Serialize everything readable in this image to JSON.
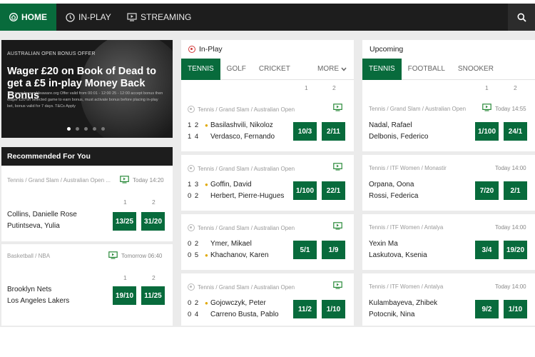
{
  "nav": {
    "home": "HOME",
    "inplay": "IN-PLAY",
    "streaming": "STREAMING"
  },
  "banner": {
    "tag": "AUSTRALIAN OPEN BONUS OFFER",
    "title": "Wager £20 on Book of Dead to get a £5 in-play Money Back Bonus",
    "fine_print": "18+ www.begambleaware.org Offer valid from 00:01 - 12:00 25 - 12:00 accept bonus then wager £20 on selected game to earn bonus, must activate bonus before placing in-play bet, bonus valid for 7 days. T&Cs Apply",
    "slides": 5,
    "active_slide": 0
  },
  "recommended": {
    "title": "Recommended For You",
    "events": [
      {
        "path": "Tennis / Grand Slam / Australian Open ...",
        "time": "Today 14:20",
        "col1": "1",
        "col2": "2",
        "team1": "Collins, Danielle Rose",
        "team2": "Putintseva, Yulia",
        "odds1": "13/25",
        "odds2": "31/20"
      },
      {
        "path": "Basketball / NBA",
        "time": "Tomorrow 06:40",
        "col1": "1",
        "col2": "2",
        "team1": "Brooklyn Nets",
        "team2": "Los Angeles Lakers",
        "odds1": "19/10",
        "odds2": "11/25"
      }
    ]
  },
  "inplay": {
    "title": "In-Play",
    "tabs": [
      "TENNIS",
      "GOLF",
      "CRICKET"
    ],
    "more": "MORE",
    "col1": "1",
    "col2": "2",
    "events": [
      {
        "path": "Tennis / Grand Slam / Australian Open",
        "p1": "Basilashvili, Nikoloz",
        "p2": "Verdasco, Fernando",
        "s1": "1 2",
        "s2": "1 4",
        "serve": 1,
        "odds1": "10/3",
        "odds2": "2/11"
      },
      {
        "path": "Tennis / Grand Slam / Australian Open",
        "p1": "Goffin, David",
        "p2": "Herbert, Pierre-Hugues",
        "s1": "1 3",
        "s2": "0 2",
        "serve": 1,
        "odds1": "1/100",
        "odds2": "22/1"
      },
      {
        "path": "Tennis / Grand Slam / Australian Open",
        "p1": "Ymer, Mikael",
        "p2": "Khachanov, Karen",
        "s1": "0 2",
        "s2": "0 5",
        "serve": 2,
        "odds1": "5/1",
        "odds2": "1/9"
      },
      {
        "path": "Tennis / Grand Slam / Australian Open",
        "p1": "Gojowczyk, Peter",
        "p2": "Carreno Busta, Pablo",
        "s1": "0 2",
        "s2": "0 4",
        "serve": 1,
        "odds1": "11/2",
        "odds2": "1/10"
      }
    ]
  },
  "upcoming": {
    "title": "Upcoming",
    "tabs": [
      "TENNIS",
      "FOOTBALL",
      "SNOOKER"
    ],
    "col1": "1",
    "col2": "2",
    "events": [
      {
        "path": "Tennis / Grand Slam / Australian Open",
        "time": "Today 14:55",
        "tv": true,
        "p1": "Nadal, Rafael",
        "p2": "Delbonis, Federico",
        "odds1": "1/100",
        "odds2": "24/1"
      },
      {
        "path": "Tennis / ITF Women / Monastir",
        "time": "Today 14:00",
        "tv": false,
        "p1": "Orpana, Oona",
        "p2": "Rossi, Federica",
        "odds1": "7/20",
        "odds2": "2/1"
      },
      {
        "path": "Tennis / ITF Women / Antalya",
        "time": "Today 14:00",
        "tv": false,
        "p1": "Yexin Ma",
        "p2": "Laskutova, Ksenia",
        "odds1": "3/4",
        "odds2": "19/20"
      },
      {
        "path": "Tennis / ITF Women / Antalya",
        "time": "Today 14:00",
        "tv": false,
        "p1": "Kulambayeva, Zhibek",
        "p2": "Potocnik, Nina",
        "odds1": "9/2",
        "odds2": "1/10"
      }
    ]
  },
  "colors": {
    "brand_green": "#086b3c",
    "nav_dark": "#1d1d1d",
    "live_red": "#d23a3a",
    "serve_yellow": "#e0a800"
  },
  "icons": [
    "home-icon",
    "clock-icon",
    "tv-icon",
    "search-icon",
    "live-icon",
    "chevron-down-icon"
  ]
}
